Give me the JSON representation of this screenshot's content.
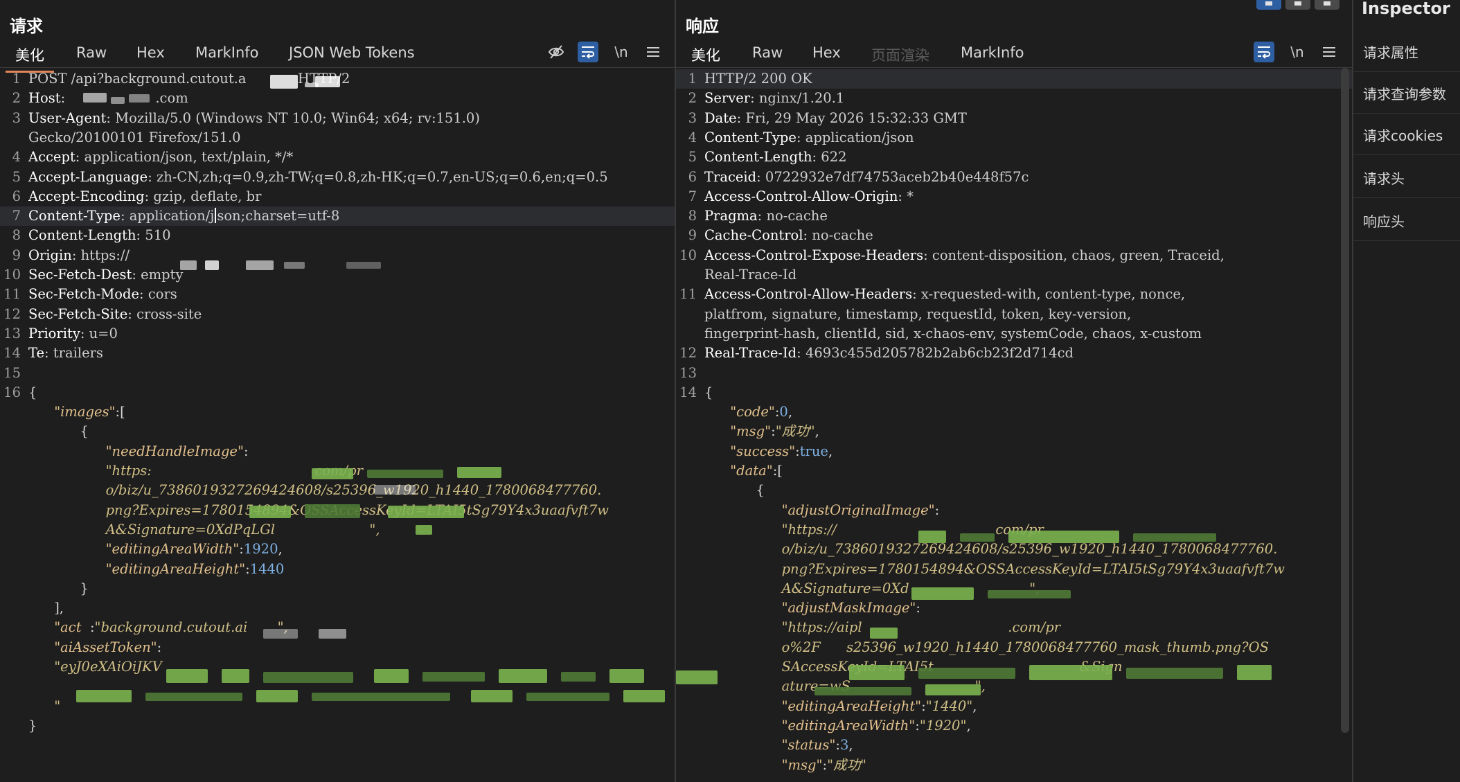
{
  "request": {
    "title": "请求",
    "tabs": [
      "美化",
      "Raw",
      "Hex",
      "MarkInfo",
      "JSON Web Tokens"
    ],
    "lines": [
      {
        "n": "1",
        "segs": [
          [
            "hval",
            "POST /api?background.cutout.a"
          ],
          [
            "hval",
            "           "
          ],
          [
            "hval",
            " HTTP/2"
          ]
        ]
      },
      {
        "n": "2",
        "segs": [
          [
            "hkey",
            "Host"
          ],
          [
            "hval",
            ": "
          ],
          [
            "hval",
            "                    .com"
          ]
        ]
      },
      {
        "n": "3",
        "segs": [
          [
            "hkey",
            "User-Agent"
          ],
          [
            "hval",
            ": Mozilla/5.0 (Windows NT 10.0; Win64; x64; rv:151.0)"
          ]
        ]
      },
      {
        "n": "",
        "segs": [
          [
            "hval",
            "Gecko/20100101 Firefox/151.0"
          ]
        ]
      },
      {
        "n": "4",
        "segs": [
          [
            "hkey",
            "Accept"
          ],
          [
            "hval",
            ": application/json, text/plain, */*"
          ]
        ]
      },
      {
        "n": "5",
        "segs": [
          [
            "hkey",
            "Accept-Language"
          ],
          [
            "hval",
            ": zh-CN,zh;q=0.9,zh-TW;q=0.8,zh-HK;q=0.7,en-US;q=0.6,en;q=0.5"
          ]
        ]
      },
      {
        "n": "6",
        "segs": [
          [
            "hkey",
            "Accept-Encoding"
          ],
          [
            "hval",
            ": gzip, deflate, br"
          ]
        ]
      },
      {
        "n": "7",
        "segs": [
          [
            "hkey",
            "Content-Type"
          ],
          [
            "hval",
            ": application/j"
          ],
          [
            "caret",
            ""
          ],
          [
            "hval",
            "son;charset=utf-8"
          ]
        ],
        "hl": true
      },
      {
        "n": "8",
        "segs": [
          [
            "hkey",
            "Content-Length"
          ],
          [
            "hval",
            ": 510"
          ]
        ]
      },
      {
        "n": "9",
        "segs": [
          [
            "hkey",
            "Origin"
          ],
          [
            "hval",
            ": https://"
          ]
        ]
      },
      {
        "n": "10",
        "segs": [
          [
            "hkey",
            "Sec-Fetch-Dest"
          ],
          [
            "hval",
            ": empty"
          ]
        ]
      },
      {
        "n": "11",
        "segs": [
          [
            "hkey",
            "Sec-Fetch-Mode"
          ],
          [
            "hval",
            ": cors"
          ]
        ]
      },
      {
        "n": "12",
        "segs": [
          [
            "hkey",
            "Sec-Fetch-Site"
          ],
          [
            "hval",
            ": cross-site"
          ]
        ]
      },
      {
        "n": "13",
        "segs": [
          [
            "hkey",
            "Priority"
          ],
          [
            "hval",
            ": u=0"
          ]
        ]
      },
      {
        "n": "14",
        "segs": [
          [
            "hkey",
            "Te"
          ],
          [
            "hval",
            ": trailers"
          ]
        ]
      },
      {
        "n": "15",
        "segs": []
      },
      {
        "n": "16",
        "segs": [
          [
            "jpunc",
            "{"
          ]
        ]
      },
      {
        "n": "",
        "segs": [
          [
            "jpunc",
            "      "
          ],
          [
            "jkey",
            "\"images\""
          ],
          [
            "jpunc",
            ":["
          ]
        ]
      },
      {
        "n": "",
        "segs": [
          [
            "jpunc",
            "            {"
          ]
        ]
      },
      {
        "n": "",
        "segs": [
          [
            "jpunc",
            "                  "
          ],
          [
            "jkey",
            "\"needHandleImage\""
          ],
          [
            "jpunc",
            ":"
          ]
        ]
      },
      {
        "n": "",
        "segs": [
          [
            "jpunc",
            "                  "
          ],
          [
            "jstr",
            "\"https:"
          ],
          [
            "jstr",
            "                                      com/pr"
          ]
        ]
      },
      {
        "n": "",
        "segs": [
          [
            "jpunc",
            "                  "
          ],
          [
            "jstr",
            "o/biz/u_7386019327269424608/s25396_w1920_h1440_1780068477760."
          ]
        ]
      },
      {
        "n": "",
        "segs": [
          [
            "jpunc",
            "                  "
          ],
          [
            "jstr",
            "png?Expires=1780154894&OSSAccessKeyId=LTAI5tSg79Y4x3uaafvft7w"
          ]
        ]
      },
      {
        "n": "",
        "segs": [
          [
            "jpunc",
            "                  "
          ],
          [
            "jstr",
            "A&Signature=0XdPqLGl"
          ],
          [
            "jstr",
            "                      \","
          ]
        ]
      },
      {
        "n": "",
        "segs": [
          [
            "jpunc",
            "                  "
          ],
          [
            "jkey",
            "\"editingAreaWidth\""
          ],
          [
            "jpunc",
            ":"
          ],
          [
            "jnum",
            "1920"
          ],
          [
            "jpunc",
            ","
          ]
        ]
      },
      {
        "n": "",
        "segs": [
          [
            "jpunc",
            "                  "
          ],
          [
            "jkey",
            "\"editingAreaHeight\""
          ],
          [
            "jpunc",
            ":"
          ],
          [
            "jnum",
            "1440"
          ]
        ]
      },
      {
        "n": "",
        "segs": [
          [
            "jpunc",
            "            }"
          ]
        ]
      },
      {
        "n": "",
        "segs": [
          [
            "jpunc",
            "      ],"
          ]
        ]
      },
      {
        "n": "",
        "segs": [
          [
            "jpunc",
            "      "
          ],
          [
            "jkey",
            "\"act"
          ],
          [
            "jpunc",
            "  :"
          ],
          [
            "jstr",
            "\"background.cutout.ai"
          ],
          [
            "jstr",
            "       \","
          ]
        ]
      },
      {
        "n": "",
        "segs": [
          [
            "jpunc",
            "      "
          ],
          [
            "jkey",
            "\"aiAssetToken\""
          ],
          [
            "jpunc",
            ":"
          ]
        ]
      },
      {
        "n": "",
        "segs": [
          [
            "jpunc",
            "      "
          ],
          [
            "jstr",
            "\"eyJ0eXAiOiJKV"
          ]
        ]
      },
      {
        "n": "",
        "segs": []
      },
      {
        "n": "",
        "segs": [
          [
            "jpunc",
            "      "
          ],
          [
            "jstr",
            "\""
          ]
        ]
      },
      {
        "n": "",
        "segs": [
          [
            "jpunc",
            "}"
          ]
        ]
      }
    ]
  },
  "response": {
    "title": "响应",
    "tabs": [
      "美化",
      "Raw",
      "Hex",
      "页面渲染",
      "MarkInfo"
    ],
    "lines": [
      {
        "n": "1",
        "segs": [
          [
            "hval",
            "HTTP/2 200 OK"
          ]
        ],
        "hl": true
      },
      {
        "n": "2",
        "segs": [
          [
            "hkey",
            "Server"
          ],
          [
            "hval",
            ": nginx/1.20.1"
          ]
        ]
      },
      {
        "n": "3",
        "segs": [
          [
            "hkey",
            "Date"
          ],
          [
            "hval",
            ": Fri, 29 May 2026 15:32:33 GMT"
          ]
        ]
      },
      {
        "n": "4",
        "segs": [
          [
            "hkey",
            "Content-Type"
          ],
          [
            "hval",
            ": application/json"
          ]
        ]
      },
      {
        "n": "5",
        "segs": [
          [
            "hkey",
            "Content-Length"
          ],
          [
            "hval",
            ": 622"
          ]
        ]
      },
      {
        "n": "6",
        "segs": [
          [
            "hkey",
            "Traceid"
          ],
          [
            "hval",
            ": 0722932e7df74753aceb2b40e448f57c"
          ]
        ]
      },
      {
        "n": "7",
        "segs": [
          [
            "hkey",
            "Access-Control-Allow-Origin"
          ],
          [
            "hval",
            ": *"
          ]
        ]
      },
      {
        "n": "8",
        "segs": [
          [
            "hkey",
            "Pragma"
          ],
          [
            "hval",
            ": no-cache"
          ]
        ]
      },
      {
        "n": "9",
        "segs": [
          [
            "hkey",
            "Cache-Control"
          ],
          [
            "hval",
            ": no-cache"
          ]
        ]
      },
      {
        "n": "10",
        "segs": [
          [
            "hkey",
            "Access-Control-Expose-Headers"
          ],
          [
            "hval",
            ": content-disposition, chaos, green, Traceid,"
          ]
        ]
      },
      {
        "n": "",
        "segs": [
          [
            "hval",
            "Real-Trace-Id"
          ]
        ]
      },
      {
        "n": "11",
        "segs": [
          [
            "hkey",
            "Access-Control-Allow-Headers"
          ],
          [
            "hval",
            ": x-requested-with, content-type, nonce,"
          ]
        ]
      },
      {
        "n": "",
        "segs": [
          [
            "hval",
            "platfrom, signature, timestamp, requestId, token, key-version,"
          ]
        ]
      },
      {
        "n": "",
        "segs": [
          [
            "hval",
            "fingerprint-hash, clientId, sid, x-chaos-env, systemCode, chaos, x-custom"
          ]
        ]
      },
      {
        "n": "12",
        "segs": [
          [
            "hkey",
            "Real-Trace-Id"
          ],
          [
            "hval",
            ": 4693c455d205782b2ab6cb23f2d714cd"
          ]
        ]
      },
      {
        "n": "13",
        "segs": []
      },
      {
        "n": "14",
        "segs": [
          [
            "jpunc",
            "{"
          ]
        ]
      },
      {
        "n": "",
        "segs": [
          [
            "jpunc",
            "      "
          ],
          [
            "jkey",
            "\"code\""
          ],
          [
            "jpunc",
            ":"
          ],
          [
            "jnum",
            "0"
          ],
          [
            "jpunc",
            ","
          ]
        ]
      },
      {
        "n": "",
        "segs": [
          [
            "jpunc",
            "      "
          ],
          [
            "jkey",
            "\"msg\""
          ],
          [
            "jpunc",
            ":"
          ],
          [
            "jstr",
            "\"成功\""
          ],
          [
            "jpunc",
            ","
          ]
        ]
      },
      {
        "n": "",
        "segs": [
          [
            "jpunc",
            "      "
          ],
          [
            "jkey",
            "\"success\""
          ],
          [
            "jpunc",
            ":"
          ],
          [
            "jnum",
            "true"
          ],
          [
            "jpunc",
            ","
          ]
        ]
      },
      {
        "n": "",
        "segs": [
          [
            "jpunc",
            "      "
          ],
          [
            "jkey",
            "\"data\""
          ],
          [
            "jpunc",
            ":["
          ]
        ]
      },
      {
        "n": "",
        "segs": [
          [
            "jpunc",
            "            {"
          ]
        ]
      },
      {
        "n": "",
        "segs": [
          [
            "jpunc",
            "                  "
          ],
          [
            "jkey",
            "\"adjustOriginalImage\""
          ],
          [
            "jpunc",
            ":"
          ]
        ]
      },
      {
        "n": "",
        "segs": [
          [
            "jpunc",
            "                  "
          ],
          [
            "jstr",
            "\"https://"
          ],
          [
            "jstr",
            "                                     com/pr"
          ]
        ]
      },
      {
        "n": "",
        "segs": [
          [
            "jpunc",
            "                  "
          ],
          [
            "jstr",
            "o/biz/u_7386019327269424608/s25396_w1920_h1440_1780068477760."
          ]
        ]
      },
      {
        "n": "",
        "segs": [
          [
            "jpunc",
            "                  "
          ],
          [
            "jstr",
            "png?Expires=1780154894&OSSAccessKeyId=LTAI5tSg79Y4x3uaafvft7w"
          ]
        ]
      },
      {
        "n": "",
        "segs": [
          [
            "jpunc",
            "                  "
          ],
          [
            "jstr",
            "A&Signature=0Xd"
          ],
          [
            "jstr",
            "                            \","
          ]
        ]
      },
      {
        "n": "",
        "segs": [
          [
            "jpunc",
            "                  "
          ],
          [
            "jkey",
            "\"adjustMaskImage\""
          ],
          [
            "jpunc",
            ":"
          ]
        ]
      },
      {
        "n": "",
        "segs": [
          [
            "jpunc",
            "                  "
          ],
          [
            "jstr",
            "\"https://aipl"
          ],
          [
            "jstr",
            "                                  .com/pr"
          ]
        ]
      },
      {
        "n": "",
        "segs": [
          [
            "jpunc",
            "                  "
          ],
          [
            "jstr",
            "o%2F"
          ],
          [
            "jstr",
            "      s25396_w1920_h1440_1780068477760_mask_thumb.png?OS"
          ]
        ]
      },
      {
        "n": "",
        "segs": [
          [
            "jpunc",
            "                  "
          ],
          [
            "jstr",
            "SAccessKeyId=LTAI5t"
          ],
          [
            "jstr",
            "                                  &Sign"
          ]
        ]
      },
      {
        "n": "",
        "segs": [
          [
            "jpunc",
            "                  "
          ],
          [
            "jstr",
            "ature=wS"
          ],
          [
            "jstr",
            "                             \","
          ]
        ]
      },
      {
        "n": "",
        "segs": [
          [
            "jpunc",
            "                  "
          ],
          [
            "jkey",
            "\"editingAreaHeight\""
          ],
          [
            "jpunc",
            ":"
          ],
          [
            "jstr",
            "\"1440\""
          ],
          [
            "jpunc",
            ","
          ]
        ]
      },
      {
        "n": "",
        "segs": [
          [
            "jpunc",
            "                  "
          ],
          [
            "jkey",
            "\"editingAreaWidth\""
          ],
          [
            "jpunc",
            ":"
          ],
          [
            "jstr",
            "\"1920\""
          ],
          [
            "jpunc",
            ","
          ]
        ]
      },
      {
        "n": "",
        "segs": [
          [
            "jpunc",
            "                  "
          ],
          [
            "jkey",
            "\"status\""
          ],
          [
            "jpunc",
            ":"
          ],
          [
            "jnum",
            "3"
          ],
          [
            "jpunc",
            ","
          ]
        ]
      },
      {
        "n": "",
        "segs": [
          [
            "jpunc",
            "                  "
          ],
          [
            "jkey",
            "\"msg\""
          ],
          [
            "jpunc",
            ":"
          ],
          [
            "jstr",
            "\"成功\""
          ]
        ]
      }
    ]
  },
  "inspector": {
    "title": "Inspector",
    "items": [
      "请求属性",
      "请求查询参数",
      "请求cookies",
      "请求头",
      "响应头"
    ]
  },
  "icons": {
    "hide": "eye-off-icon",
    "wrap": "word-wrap-icon",
    "newline": "\\n",
    "menu": "hamburger-menu-icon"
  },
  "colors": {
    "accent_tab": "#e2865b",
    "toggle_on": "#2f5fa3",
    "json_key": "#e2c08d",
    "json_number": "#7fb2e5"
  }
}
